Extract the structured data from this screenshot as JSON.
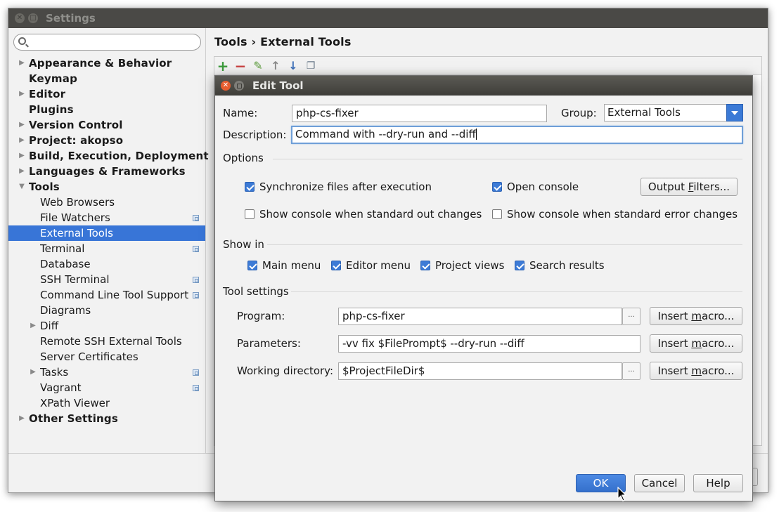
{
  "settings_window": {
    "title": "Settings",
    "search": {
      "value": "",
      "placeholder": ""
    },
    "tree": [
      {
        "label": "Appearance & Behavior",
        "level": 0,
        "expandable": true,
        "expanded": false
      },
      {
        "label": "Keymap",
        "level": 0,
        "expandable": false
      },
      {
        "label": "Editor",
        "level": 0,
        "expandable": true,
        "expanded": false
      },
      {
        "label": "Plugins",
        "level": 0,
        "expandable": false
      },
      {
        "label": "Version Control",
        "level": 0,
        "expandable": true,
        "expanded": false
      },
      {
        "label": "Project: akopso",
        "level": 0,
        "expandable": true,
        "expanded": false
      },
      {
        "label": "Build, Execution, Deployment",
        "level": 0,
        "expandable": true,
        "expanded": false
      },
      {
        "label": "Languages & Frameworks",
        "level": 0,
        "expandable": true,
        "expanded": false
      },
      {
        "label": "Tools",
        "level": 0,
        "expandable": true,
        "expanded": true
      },
      {
        "label": "Web Browsers",
        "level": 1
      },
      {
        "label": "File Watchers",
        "level": 1,
        "project_icon": true
      },
      {
        "label": "External Tools",
        "level": 1,
        "selected": true
      },
      {
        "label": "Terminal",
        "level": 1,
        "project_icon": true
      },
      {
        "label": "Database",
        "level": 1
      },
      {
        "label": "SSH Terminal",
        "level": 1,
        "project_icon": true
      },
      {
        "label": "Command Line Tool Support",
        "level": 1,
        "project_icon": true
      },
      {
        "label": "Diagrams",
        "level": 1
      },
      {
        "label": "Diff",
        "level": 1,
        "expandable": true,
        "expanded": false
      },
      {
        "label": "Remote SSH External Tools",
        "level": 1
      },
      {
        "label": "Server Certificates",
        "level": 1
      },
      {
        "label": "Tasks",
        "level": 1,
        "expandable": true,
        "expanded": false,
        "project_icon": true
      },
      {
        "label": "Vagrant",
        "level": 1,
        "project_icon": true
      },
      {
        "label": "XPath Viewer",
        "level": 1
      },
      {
        "label": "Other Settings",
        "level": 0,
        "expandable": true,
        "expanded": false
      }
    ],
    "breadcrumb": "Tools › External Tools",
    "toolbar_icons": [
      "add-icon",
      "remove-icon",
      "edit-icon",
      "move-up-icon",
      "move-down-icon",
      "copy-icon"
    ]
  },
  "edit_tool_dialog": {
    "title": "Edit Tool",
    "name_label": "Name:",
    "name_value": "php-cs-fixer",
    "group_label": "Group:",
    "group_value": "External Tools",
    "description_label": "Description:",
    "description_value": "Command with --dry-run and --diff",
    "options": {
      "title": "Options",
      "sync_files": {
        "label": "Synchronize files after execution",
        "checked": true
      },
      "open_console": {
        "label": "Open console",
        "checked": true
      },
      "output_filters_button": {
        "pre": "Output ",
        "mnemonic": "F",
        "post": "ilters..."
      },
      "show_console_stdout": {
        "label": "Show console when standard out changes",
        "checked": false
      },
      "show_console_stderr": {
        "label": "Show console when standard error changes",
        "checked": false
      }
    },
    "show_in": {
      "title": "Show in",
      "items": [
        {
          "label": "Main menu",
          "checked": true
        },
        {
          "label": "Editor menu",
          "checked": true
        },
        {
          "label": "Project views",
          "checked": true
        },
        {
          "label": "Search results",
          "checked": true
        }
      ]
    },
    "tool_settings": {
      "title": "Tool settings",
      "program_label": "Program:",
      "program_value": "php-cs-fixer",
      "parameters_label": "Parameters:",
      "parameters_value": "-vv fix $FilePrompt$ --dry-run --diff",
      "working_dir_label": "Working directory:",
      "working_dir_value": "$ProjectFileDir$",
      "browse_label": "...",
      "insert_macro": {
        "pre": "Insert ",
        "mnemonic": "m",
        "post": "acro..."
      }
    },
    "buttons": {
      "ok": "OK",
      "cancel": "Cancel",
      "help": "Help"
    }
  },
  "colors": {
    "selection": "#3875d7",
    "primary_button": "#3d7bd6",
    "titlebar": "#4a4946",
    "close_button": "#e85d2f"
  }
}
